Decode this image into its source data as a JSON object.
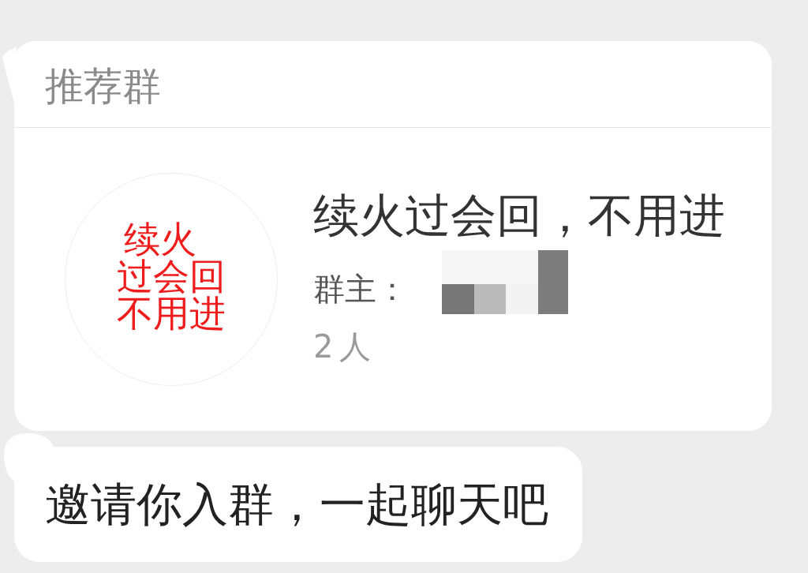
{
  "card": {
    "title": "推荐群",
    "group": {
      "avatar_text": [
        "续火",
        "过会回",
        "不用进"
      ],
      "name": "续火过会回，不用进",
      "owner": {
        "label": "群主：",
        "name_hidden": true
      },
      "members": "2人"
    }
  },
  "message": {
    "text": "邀请你入群，一起聊天吧"
  }
}
